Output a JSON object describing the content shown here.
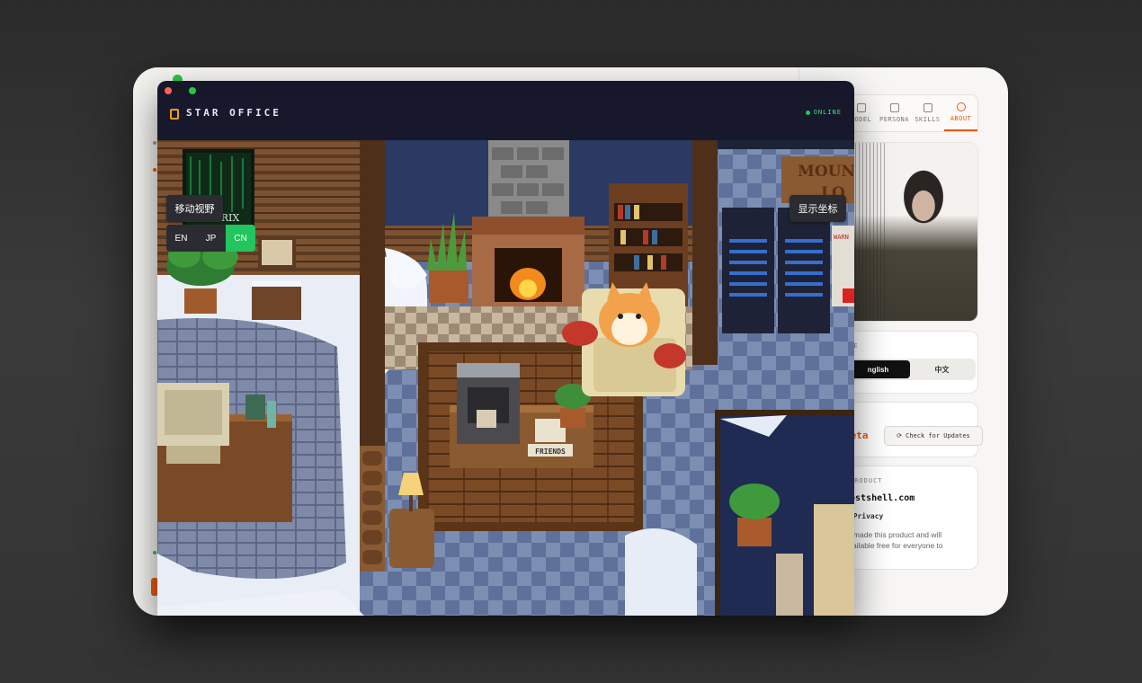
{
  "back_window": {
    "tabs": [
      {
        "label": "MODEL",
        "icon": "chat-icon"
      },
      {
        "label": "PERSONA",
        "icon": "chip-icon"
      },
      {
        "label": "SKILLS",
        "icon": "puzzle-icon"
      },
      {
        "label": "ABOUT",
        "icon": "info-icon"
      }
    ],
    "language_section": {
      "label": "AGE",
      "options": [
        "nglish",
        "中文"
      ],
      "selected": "nglish"
    },
    "version_section": {
      "label": "ON",
      "version": "beta",
      "update_button": "Check for Updates"
    },
    "product_section": {
      "label": "PRODUCT",
      "domain": "hostshell.com",
      "privacy": "· Privacy",
      "note": "Xi made this product and will available free for everyone to"
    },
    "accent_color": "#ea580c"
  },
  "game_window": {
    "title": "STAR OFFICE",
    "status": "ONLINE",
    "move_view_button": "移动视野",
    "show_coords_button": "显示坐标",
    "languages": [
      "EN",
      "JP",
      "CN"
    ],
    "active_language": "CN",
    "scene": {
      "poster_text": "MATRIX",
      "sign_text": [
        "MOUN",
        "LO"
      ],
      "mug_label": "FRIENDS",
      "warning_text": "WARN"
    },
    "status_color": "#22c55e"
  }
}
